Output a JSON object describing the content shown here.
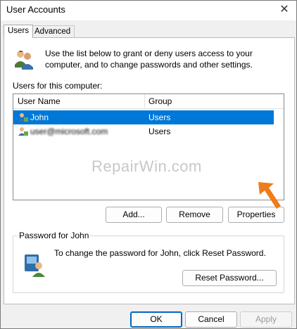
{
  "window": {
    "title": "User Accounts"
  },
  "tabs": [
    {
      "label": "Users",
      "active": true
    },
    {
      "label": "Advanced",
      "active": false
    }
  ],
  "intro": {
    "text": "Use the list below to grant or deny users access to your computer, and to change passwords and other settings."
  },
  "users_section": {
    "label": "Users for this computer:",
    "columns": [
      "User Name",
      "Group"
    ],
    "rows": [
      {
        "name": "John",
        "group": "Users",
        "selected": true
      },
      {
        "name": "user@microsoft.com",
        "group": "Users",
        "selected": false
      }
    ]
  },
  "watermark": "RepairWin.com",
  "user_buttons": {
    "add": "Add...",
    "remove": "Remove",
    "properties": "Properties"
  },
  "password_group": {
    "label": "Password for John",
    "text": "To change the password for John, click Reset Password.",
    "reset_button": "Reset Password..."
  },
  "dialog_buttons": {
    "ok": "OK",
    "cancel": "Cancel",
    "apply": "Apply"
  },
  "colors": {
    "selection": "#0078d7",
    "annotation_arrow": "#f07c1a",
    "focus_border": "#0067c0"
  }
}
